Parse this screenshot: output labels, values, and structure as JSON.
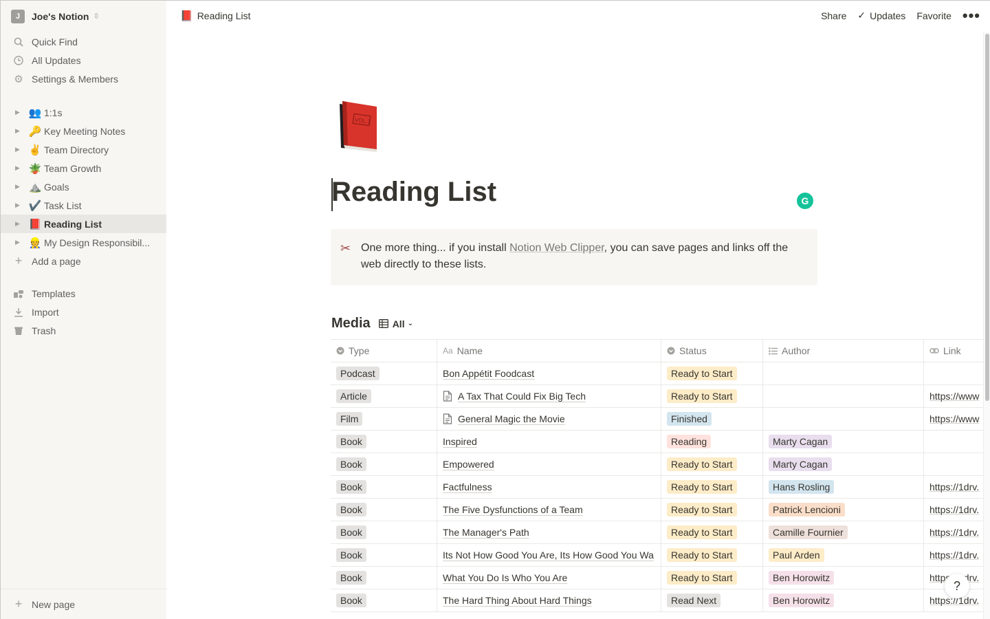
{
  "workspace": {
    "avatar": "J",
    "name": "Joe's Notion"
  },
  "sidebar": {
    "top_items": [
      {
        "label": "Quick Find",
        "icon": "search-icon"
      },
      {
        "label": "All Updates",
        "icon": "clock-icon"
      },
      {
        "label": "Settings & Members",
        "icon": "gear-icon"
      }
    ],
    "pages": [
      {
        "emoji": "👥",
        "label": "1:1s"
      },
      {
        "emoji": "🔑",
        "label": "Key Meeting Notes"
      },
      {
        "emoji": "✌️",
        "label": "Team Directory"
      },
      {
        "emoji": "🪴",
        "label": "Team Growth"
      },
      {
        "emoji": "⛰️",
        "label": "Goals"
      },
      {
        "emoji": "✔️",
        "label": "Task List"
      },
      {
        "emoji": "📕",
        "label": "Reading List"
      },
      {
        "emoji": "👷",
        "label": "My Design Responsibil..."
      }
    ],
    "add_page": "Add a page",
    "bottom_items": [
      {
        "label": "Templates",
        "icon": "templates-icon"
      },
      {
        "label": "Import",
        "icon": "download-icon"
      },
      {
        "label": "Trash",
        "icon": "trash-icon"
      }
    ],
    "new_page": "New page"
  },
  "topbar": {
    "breadcrumb_emoji": "📕",
    "breadcrumb": "Reading List",
    "share": "Share",
    "updates": "Updates",
    "favorite": "Favorite",
    "more": "•••"
  },
  "page": {
    "title": "Reading List",
    "icon": "red-book-icon",
    "callout": {
      "icon": "scissors-icon",
      "text_before": "One more thing... if you install ",
      "link_text": "Notion Web Clipper",
      "text_after": ", you can save pages and links off the web directly to these lists."
    }
  },
  "database": {
    "title": "Media",
    "view": "All",
    "columns": [
      "Type",
      "Name",
      "Status",
      "Author",
      "Link"
    ],
    "rows": [
      {
        "type": "Podcast",
        "name": "Bon Appétit Foodcast",
        "doc": false,
        "status": "Ready to Start",
        "status_color": "yellow",
        "author": "",
        "author_color": "",
        "link": ""
      },
      {
        "type": "Article",
        "name": "A Tax That Could Fix Big Tech",
        "doc": true,
        "status": "Ready to Start",
        "status_color": "yellow",
        "author": "",
        "author_color": "",
        "link": "https://www"
      },
      {
        "type": "Film",
        "name": "General Magic the Movie",
        "doc": true,
        "status": "Finished",
        "status_color": "blue",
        "author": "",
        "author_color": "",
        "link": "https://www"
      },
      {
        "type": "Book",
        "name": "Inspired",
        "doc": false,
        "status": "Reading",
        "status_color": "red",
        "author": "Marty Cagan",
        "author_color": "purple",
        "link": ""
      },
      {
        "type": "Book",
        "name": "Empowered",
        "doc": false,
        "status": "Ready to Start",
        "status_color": "yellow",
        "author": "Marty Cagan",
        "author_color": "purple",
        "link": ""
      },
      {
        "type": "Book",
        "name": "Factfulness",
        "doc": false,
        "status": "Ready to Start",
        "status_color": "yellow",
        "author": "Hans Rosling",
        "author_color": "blue",
        "link": "https://1drv."
      },
      {
        "type": "Book",
        "name": "The Five Dysfunctions of a Team",
        "doc": false,
        "status": "Ready to Start",
        "status_color": "yellow",
        "author": "Patrick Lencioni",
        "author_color": "orange",
        "link": "https://1drv."
      },
      {
        "type": "Book",
        "name": "The Manager's Path",
        "doc": false,
        "status": "Ready to Start",
        "status_color": "yellow",
        "author": "Camille Fournier",
        "author_color": "brown",
        "link": "https://1drv."
      },
      {
        "type": "Book",
        "name": "Its Not How Good You Are, Its How Good You Wa",
        "doc": false,
        "status": "Ready to Start",
        "status_color": "yellow",
        "author": "Paul Arden",
        "author_color": "yellow",
        "link": "https://1drv."
      },
      {
        "type": "Book",
        "name": "What You Do Is Who You Are",
        "doc": false,
        "status": "Ready to Start",
        "status_color": "yellow",
        "author": "Ben Horowitz",
        "author_color": "pink",
        "link": "https://1drv."
      },
      {
        "type": "Book",
        "name": "The Hard Thing About Hard Things",
        "doc": false,
        "status": "Read Next",
        "status_color": "gray",
        "author": "Ben Horowitz",
        "author_color": "pink",
        "link": "https://1drv."
      }
    ]
  },
  "help": "?",
  "colors": {
    "sidebar_bg": "#f7f6f3",
    "text": "#37352f",
    "muted": "#787774",
    "grammarly": "#15c39a"
  }
}
